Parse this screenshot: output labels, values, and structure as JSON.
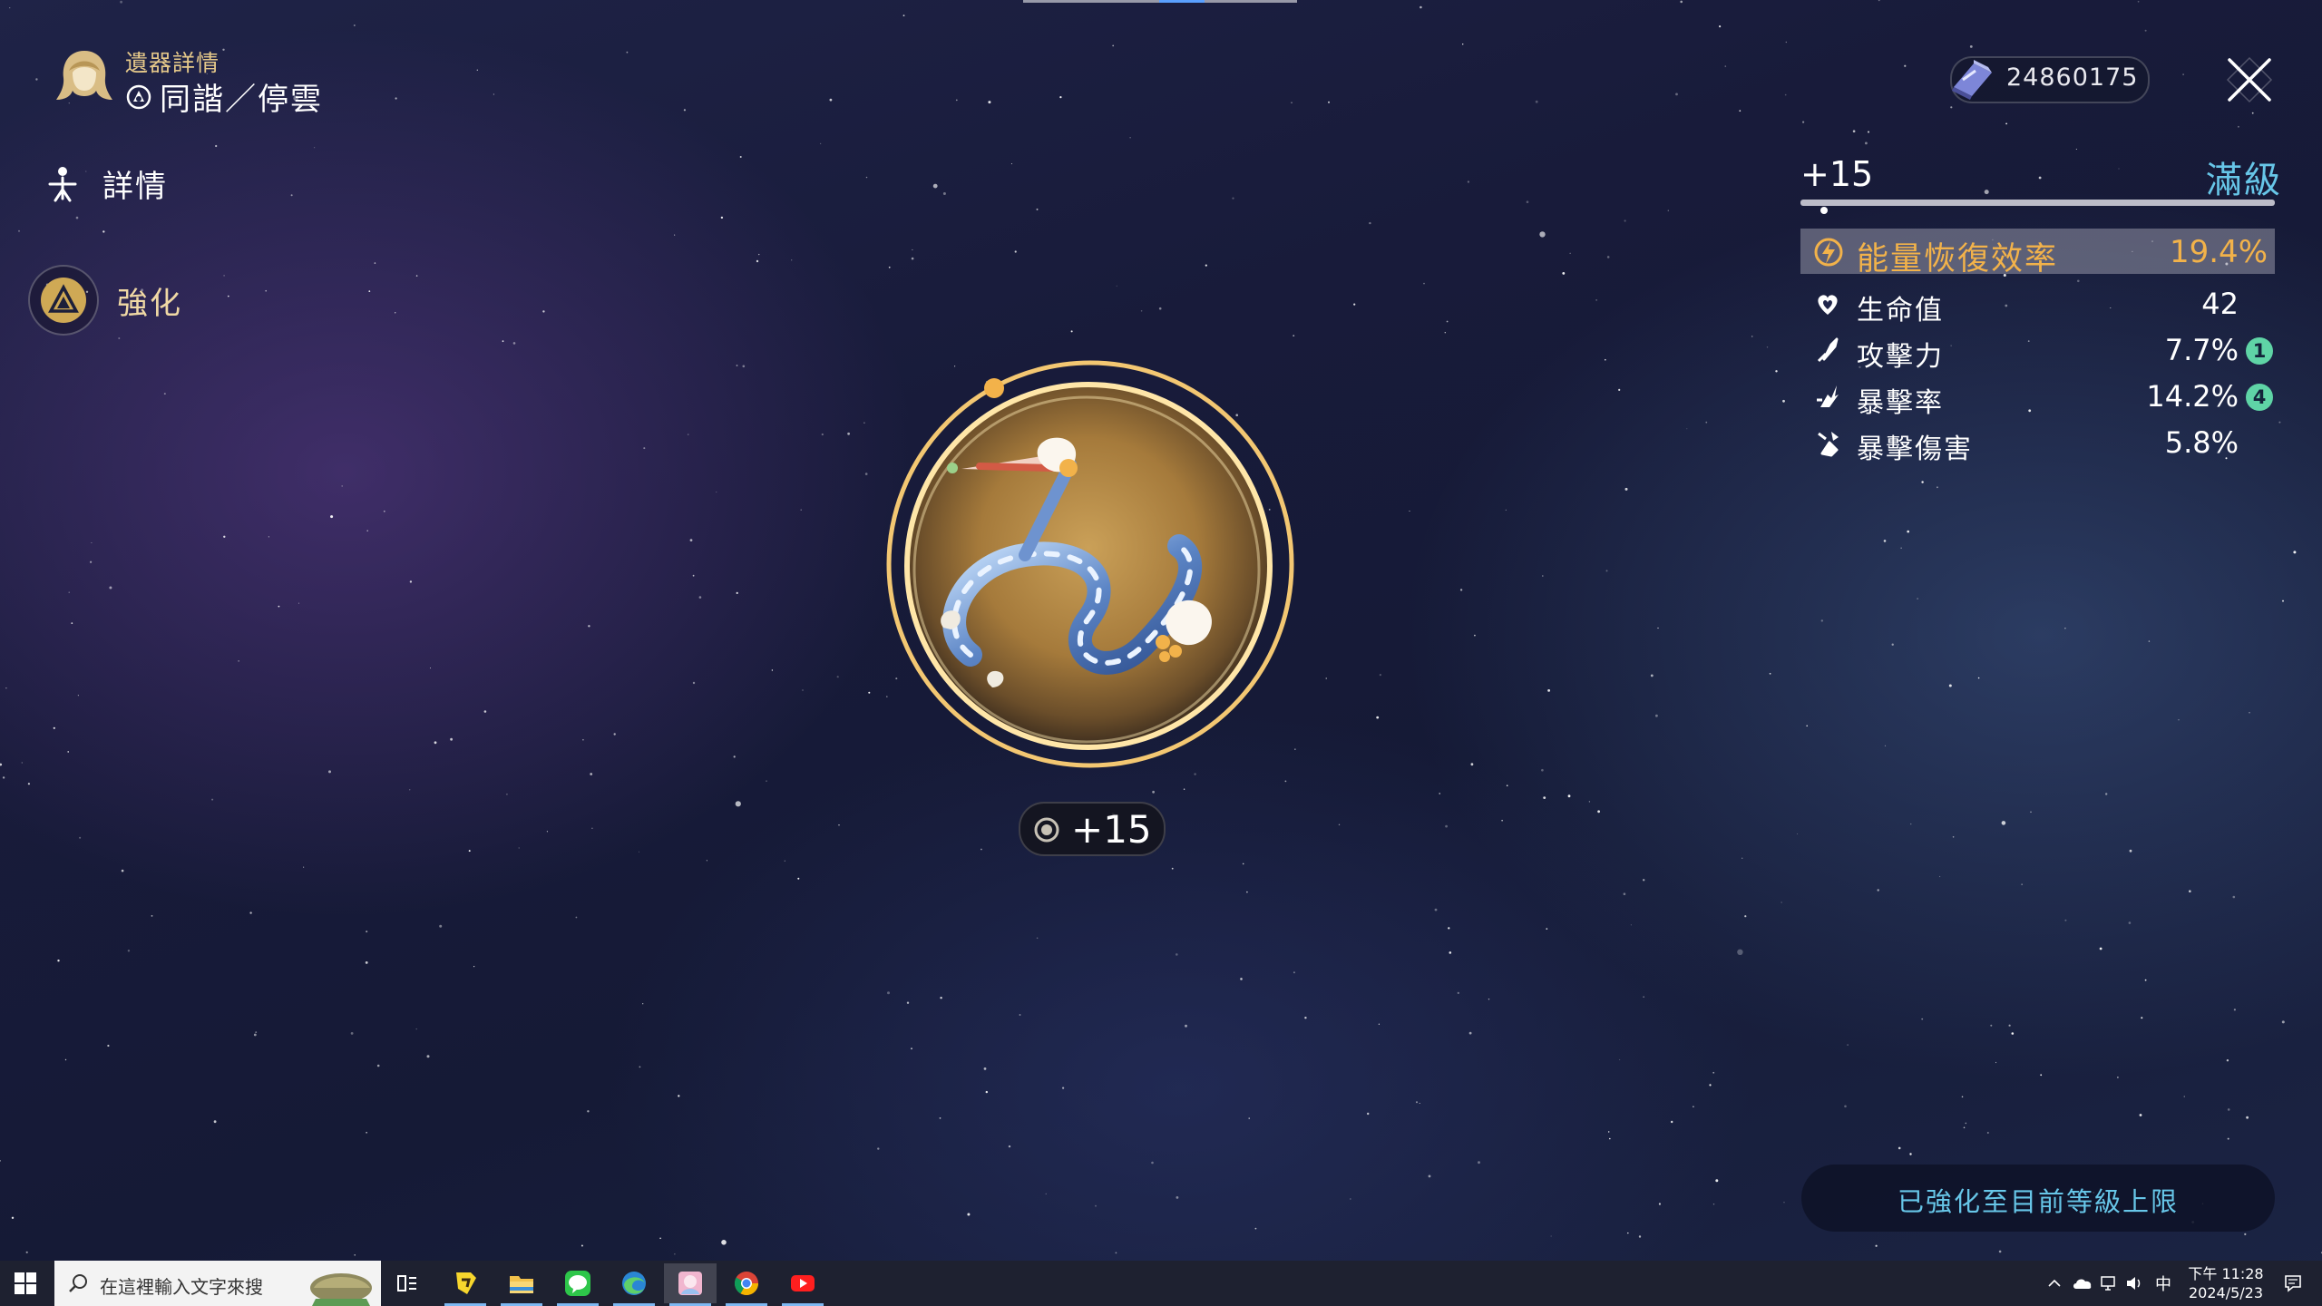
{
  "header": {
    "label": "遺器詳情",
    "relic_name": "同諧／停雲",
    "avatar_icon": "character-avatar-icon",
    "set_icon": "harmony-path-icon"
  },
  "nav": {
    "items": [
      {
        "label": "詳情",
        "icon": "path-figure-icon",
        "active": false
      },
      {
        "label": "強化",
        "icon": "enhance-icon",
        "active": true
      }
    ]
  },
  "currency": {
    "amount": "24860175",
    "icon": "relic-exp-gem-icon"
  },
  "relic": {
    "level_text": "+15",
    "max_text": "滿級",
    "level_progress": 1.0,
    "badge_level": "+15",
    "main_stat": {
      "name": "能量恢復效率",
      "value": "19.4%",
      "icon": "energy-regen-icon"
    },
    "sub_stats": [
      {
        "name": "生命值",
        "value": "42",
        "badge": "",
        "icon": "hp-icon"
      },
      {
        "name": "攻擊力",
        "value": "7.7%",
        "badge": "1",
        "icon": "atk-icon"
      },
      {
        "name": "暴擊率",
        "value": "14.2%",
        "badge": "4",
        "icon": "crit-rate-icon"
      },
      {
        "name": "暴擊傷害",
        "value": "5.8%",
        "badge": "",
        "icon": "crit-dmg-icon"
      }
    ],
    "notice": "已強化至目前等級上限",
    "image_icon": "link-rope-relic-icon"
  },
  "taskbar": {
    "search_placeholder": "在這裡輸入文字來搜",
    "apps": [
      "task-view-icon",
      "kakaotalk-icon",
      "file-explorer-icon",
      "line-icon",
      "edge-icon",
      "game-icon",
      "chrome-icon",
      "youtube-icon"
    ],
    "tray": {
      "ime": "中"
    },
    "clock": {
      "time": "下午 11:28",
      "date": "2024/5/23"
    }
  },
  "colors": {
    "accent_gold": "#f2b24a",
    "accent_cyan": "#67c6e8",
    "badge_green": "#5fd4a6",
    "label_gold": "#e6c98a"
  }
}
